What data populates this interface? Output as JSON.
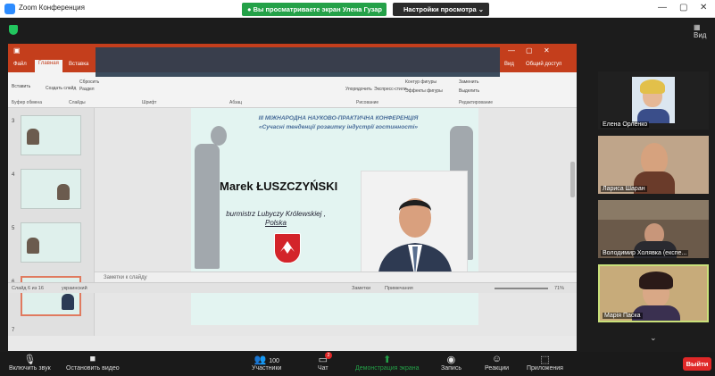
{
  "titlebar": {
    "title": "Zoom Конференция",
    "min": "—",
    "max": "▢",
    "close": "✕"
  },
  "share_banner": "● Вы просматриваете экран Улена Гузар",
  "view_settings": "Настройки просмотра ⌄",
  "view_button": "Вид",
  "ppt": {
    "tabs": [
      "Файл",
      "Главная",
      "Вставка"
    ],
    "right_tabs": [
      "Вид",
      "Общий доступ"
    ],
    "ribbon_groups": [
      "Буфер обмена",
      "Слайды",
      "Шрифт",
      "Абзац",
      "Рисование",
      "Редактирование"
    ],
    "ribbon_items": [
      "Вставить",
      "Создать слайд",
      "Сбросить",
      "Раздел",
      "Упорядочить",
      "Экспресс-стили",
      "Контур фигуры",
      "Эффекты фигуры",
      "Заменить",
      "Выделить"
    ],
    "thumb_numbers": [
      "3",
      "4",
      "5",
      "6",
      "7"
    ],
    "notes_placeholder": "Заметки к слайду",
    "status": {
      "slide": "Слайд 6 из 16",
      "lang": "украинский",
      "notes": "Заметки",
      "comments": "Примечания",
      "zoom": "71%"
    }
  },
  "slide": {
    "conf_title": "ІІІ МІЖНАРОДНА НАУКОВО-ПРАКТИЧНА КОНФЕРЕНЦІЯ",
    "conf_subtitle": "«Сучасні тенденції розвитку індустрії гостинності»",
    "speaker_name": "Marek ŁUSZCZYŃSKI",
    "speaker_role_line1": "burmistrz Lubyczy Królewskiej ,",
    "speaker_role_line2": "Polska"
  },
  "participants": [
    {
      "name": "Елена Орленко"
    },
    {
      "name": "Лариса Шаран"
    },
    {
      "name": "Володимир Холявка (експе..."
    },
    {
      "name": "Марія Паска"
    }
  ],
  "toolbar": {
    "mute": "Включить звук",
    "video": "Остановить видео",
    "participants": "Участники",
    "participants_count": "100",
    "chat": "Чат",
    "chat_badge": "2",
    "share": "Демонстрация экрана",
    "record": "Запись",
    "reactions": "Реакции",
    "apps": "Приложения",
    "leave": "Выйти"
  },
  "colors": {
    "share_green": "#24a148",
    "ppt_red": "#c43e1c",
    "leave_red": "#e02828",
    "active_speaker": "#c9e07a"
  }
}
